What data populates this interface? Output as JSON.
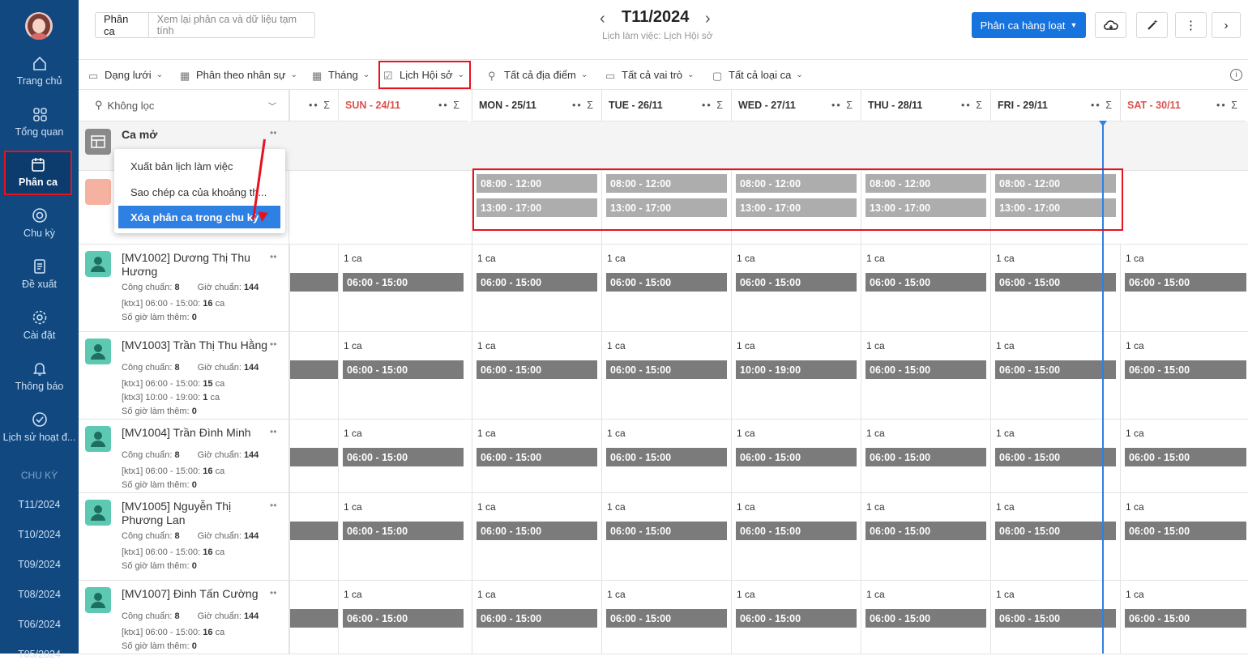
{
  "sidebar": {
    "nav": [
      {
        "label": "Trang chủ",
        "icon": "home-icon"
      },
      {
        "label": "Tổng quan",
        "icon": "grid-icon"
      },
      {
        "label": "Phân ca",
        "icon": "calendar-icon"
      },
      {
        "label": "Chu kỳ",
        "icon": "cycle-icon"
      },
      {
        "label": "Đề xuất",
        "icon": "document-icon"
      },
      {
        "label": "Cài đặt",
        "icon": "settings-icon"
      },
      {
        "label": "Thông báo",
        "icon": "bell-icon"
      },
      {
        "label": "Lịch sử hoạt đ...",
        "icon": "check-circle-icon"
      }
    ],
    "section": "CHU KỲ",
    "periods": [
      "T11/2024",
      "T10/2024",
      "T09/2024",
      "T08/2024",
      "T06/2024",
      "T05/2024"
    ]
  },
  "top": {
    "seg_active": "Phân ca",
    "seg_other": "Xem lại phân ca và dữ liệu tạm tính",
    "month": "T11/2024",
    "subtitle": "Lịch làm việc: Lịch Hội sở",
    "bulk_button": "Phân ca hàng loạt"
  },
  "toolbar": [
    "Dạng lưới",
    "Phân theo nhân sự",
    "Tháng",
    "Lịch Hội sở",
    "Tất cả địa điểm",
    "Tất cả vai trò",
    "Tất cả loại ca"
  ],
  "filter": "Không lọc",
  "days": [
    {
      "label": "SUN - 24/11",
      "weekend": true
    },
    {
      "label": "MON - 25/11",
      "weekend": false
    },
    {
      "label": "TUE - 26/11",
      "weekend": false
    },
    {
      "label": "WED - 27/11",
      "weekend": false
    },
    {
      "label": "THU - 28/11",
      "weekend": false
    },
    {
      "label": "FRI - 29/11",
      "weekend": false
    },
    {
      "label": "SAT - 30/11",
      "weekend": true
    }
  ],
  "open_shift": {
    "label": "Ca mở"
  },
  "menu": [
    "Xuất bản lịch làm việc",
    "Sao chép ca của khoảng th...",
    "Xóa phân ca trong chu kỳ"
  ],
  "template_shifts": [
    "08:00 - 12:00",
    "13:00 - 17:00"
  ],
  "count_label": "1 ca",
  "labels": {
    "cong": "Công chuẩn:",
    "gio": "Giờ chuẩn:",
    "ot": "Số giờ làm thêm:"
  },
  "employees": [
    {
      "name": "[MV1002] Dương Thị Thu Hương",
      "cong": "8",
      "gio": "144",
      "lines": [
        {
          "t": "[ktx1] 06:00 - 15:00:",
          "v": "16",
          "u": "ca"
        }
      ],
      "ot": "0",
      "shifts": [
        "06:00 - 15:00",
        "06:00 - 15:00",
        "06:00 - 15:00",
        "06:00 - 15:00",
        "06:00 - 15:00",
        "06:00 - 15:00",
        "06:00 - 15:00"
      ]
    },
    {
      "name": "[MV1003] Trần Thị Thu Hằng",
      "cong": "8",
      "gio": "144",
      "lines": [
        {
          "t": "[ktx1] 06:00 - 15:00:",
          "v": "15",
          "u": "ca"
        },
        {
          "t": "[ktx3] 10:00 - 19:00:",
          "v": "1",
          "u": "ca"
        }
      ],
      "ot": "0",
      "shifts": [
        "06:00 - 15:00",
        "06:00 - 15:00",
        "06:00 - 15:00",
        "10:00 - 19:00",
        "06:00 - 15:00",
        "06:00 - 15:00",
        "06:00 - 15:00"
      ]
    },
    {
      "name": "[MV1004] Trần Đình Minh",
      "cong": "8",
      "gio": "144",
      "lines": [
        {
          "t": "[ktx1] 06:00 - 15:00:",
          "v": "16",
          "u": "ca"
        }
      ],
      "ot": "0",
      "shifts": [
        "06:00 - 15:00",
        "06:00 - 15:00",
        "06:00 - 15:00",
        "06:00 - 15:00",
        "06:00 - 15:00",
        "06:00 - 15:00",
        "06:00 - 15:00"
      ]
    },
    {
      "name": "[MV1005] Nguyễn Thị Phương Lan",
      "cong": "8",
      "gio": "144",
      "lines": [
        {
          "t": "[ktx1] 06:00 - 15:00:",
          "v": "16",
          "u": "ca"
        }
      ],
      "ot": "0",
      "shifts": [
        "06:00 - 15:00",
        "06:00 - 15:00",
        "06:00 - 15:00",
        "06:00 - 15:00",
        "06:00 - 15:00",
        "06:00 - 15:00",
        "06:00 - 15:00"
      ]
    },
    {
      "name": "[MV1007] Đinh Tấn Cường",
      "cong": "8",
      "gio": "144",
      "lines": [
        {
          "t": "[ktx1] 06:00 - 15:00:",
          "v": "16",
          "u": "ca"
        }
      ],
      "ot": "0",
      "shifts": [
        "06:00 - 15:00",
        "06:00 - 15:00",
        "06:00 - 15:00",
        "06:00 - 15:00",
        "06:00 - 15:00",
        "06:00 - 15:00",
        "06:00 - 15:00"
      ]
    }
  ]
}
